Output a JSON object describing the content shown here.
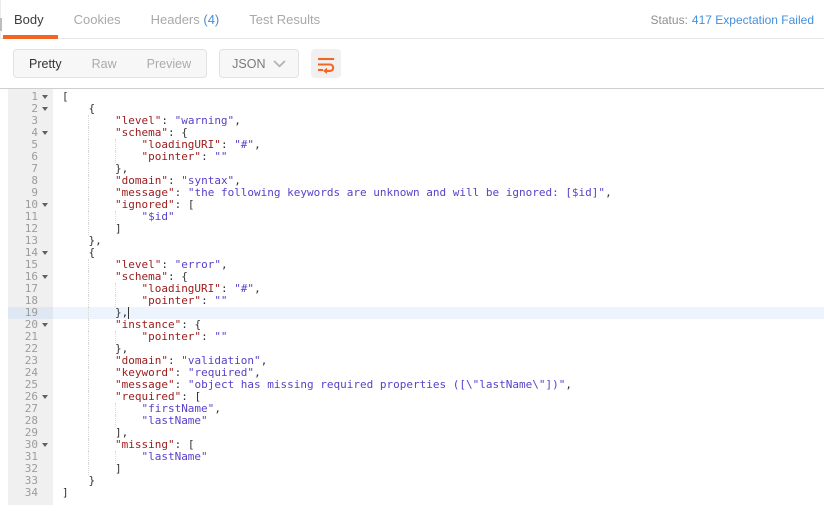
{
  "colors": {
    "accent_orange": "#f26524",
    "link_blue": "#4390db",
    "json_key": "#9b1b1b",
    "json_string": "#5a3fc8",
    "gutter_bg": "#f0f0f0",
    "active_line_bg": "#edf4fd"
  },
  "tabs": {
    "body": "Body",
    "cookies": "Cookies",
    "headers": "Headers",
    "headers_count": "(4)",
    "test_results": "Test Results"
  },
  "status": {
    "label": "Status:",
    "value": "417 Expectation Failed"
  },
  "toolbar": {
    "pretty": "Pretty",
    "raw": "Raw",
    "preview": "Preview",
    "language": "JSON",
    "chevron_icon": "chevron-down-icon",
    "wrap_icon": "wrap-lines-icon"
  },
  "editor": {
    "active_line": 19,
    "lines": [
      {
        "n": 1,
        "fold": true,
        "indent": 0,
        "toks": [
          [
            "p",
            "["
          ]
        ]
      },
      {
        "n": 2,
        "fold": true,
        "indent": 4,
        "toks": [
          [
            "p",
            "{"
          ]
        ]
      },
      {
        "n": 3,
        "indent": 8,
        "toks": [
          [
            "k",
            "\"level\""
          ],
          [
            "p",
            ": "
          ],
          [
            "v",
            "\"warning\""
          ],
          [
            "p",
            ","
          ]
        ]
      },
      {
        "n": 4,
        "fold": true,
        "indent": 8,
        "toks": [
          [
            "k",
            "\"schema\""
          ],
          [
            "p",
            ": {"
          ]
        ]
      },
      {
        "n": 5,
        "indent": 12,
        "toks": [
          [
            "k",
            "\"loadingURI\""
          ],
          [
            "p",
            ": "
          ],
          [
            "v",
            "\"#\""
          ],
          [
            "p",
            ","
          ]
        ]
      },
      {
        "n": 6,
        "indent": 12,
        "toks": [
          [
            "k",
            "\"pointer\""
          ],
          [
            "p",
            ": "
          ],
          [
            "v",
            "\"\""
          ]
        ]
      },
      {
        "n": 7,
        "indent": 8,
        "toks": [
          [
            "p",
            "},"
          ]
        ]
      },
      {
        "n": 8,
        "indent": 8,
        "toks": [
          [
            "k",
            "\"domain\""
          ],
          [
            "p",
            ": "
          ],
          [
            "v",
            "\"syntax\""
          ],
          [
            "p",
            ","
          ]
        ]
      },
      {
        "n": 9,
        "indent": 8,
        "toks": [
          [
            "k",
            "\"message\""
          ],
          [
            "p",
            ": "
          ],
          [
            "v",
            "\"the following keywords are unknown and will be ignored: [$id]\""
          ],
          [
            "p",
            ","
          ]
        ]
      },
      {
        "n": 10,
        "fold": true,
        "indent": 8,
        "toks": [
          [
            "k",
            "\"ignored\""
          ],
          [
            "p",
            ": ["
          ]
        ]
      },
      {
        "n": 11,
        "indent": 12,
        "toks": [
          [
            "v",
            "\"$id\""
          ]
        ]
      },
      {
        "n": 12,
        "indent": 8,
        "toks": [
          [
            "p",
            "]"
          ]
        ]
      },
      {
        "n": 13,
        "indent": 4,
        "toks": [
          [
            "p",
            "},"
          ]
        ]
      },
      {
        "n": 14,
        "fold": true,
        "indent": 4,
        "toks": [
          [
            "p",
            "{"
          ]
        ]
      },
      {
        "n": 15,
        "indent": 8,
        "toks": [
          [
            "k",
            "\"level\""
          ],
          [
            "p",
            ": "
          ],
          [
            "v",
            "\"error\""
          ],
          [
            "p",
            ","
          ]
        ]
      },
      {
        "n": 16,
        "fold": true,
        "indent": 8,
        "toks": [
          [
            "k",
            "\"schema\""
          ],
          [
            "p",
            ": {"
          ]
        ]
      },
      {
        "n": 17,
        "indent": 12,
        "toks": [
          [
            "k",
            "\"loadingURI\""
          ],
          [
            "p",
            ": "
          ],
          [
            "v",
            "\"#\""
          ],
          [
            "p",
            ","
          ]
        ]
      },
      {
        "n": 18,
        "indent": 12,
        "toks": [
          [
            "k",
            "\"pointer\""
          ],
          [
            "p",
            ": "
          ],
          [
            "v",
            "\"\""
          ]
        ]
      },
      {
        "n": 19,
        "indent": 8,
        "active": true,
        "cursor": true,
        "toks": [
          [
            "p",
            "},"
          ]
        ]
      },
      {
        "n": 20,
        "fold": true,
        "indent": 8,
        "toks": [
          [
            "k",
            "\"instance\""
          ],
          [
            "p",
            ": {"
          ]
        ]
      },
      {
        "n": 21,
        "indent": 12,
        "toks": [
          [
            "k",
            "\"pointer\""
          ],
          [
            "p",
            ": "
          ],
          [
            "v",
            "\"\""
          ]
        ]
      },
      {
        "n": 22,
        "indent": 8,
        "toks": [
          [
            "p",
            "},"
          ]
        ]
      },
      {
        "n": 23,
        "indent": 8,
        "toks": [
          [
            "k",
            "\"domain\""
          ],
          [
            "p",
            ": "
          ],
          [
            "v",
            "\"validation\""
          ],
          [
            "p",
            ","
          ]
        ]
      },
      {
        "n": 24,
        "indent": 8,
        "toks": [
          [
            "k",
            "\"keyword\""
          ],
          [
            "p",
            ": "
          ],
          [
            "v",
            "\"required\""
          ],
          [
            "p",
            ","
          ]
        ]
      },
      {
        "n": 25,
        "indent": 8,
        "toks": [
          [
            "k",
            "\"message\""
          ],
          [
            "p",
            ": "
          ],
          [
            "v",
            "\"object has missing required properties ([\\\"lastName\\\"])\""
          ],
          [
            "p",
            ","
          ]
        ]
      },
      {
        "n": 26,
        "fold": true,
        "indent": 8,
        "toks": [
          [
            "k",
            "\"required\""
          ],
          [
            "p",
            ": ["
          ]
        ]
      },
      {
        "n": 27,
        "indent": 12,
        "toks": [
          [
            "v",
            "\"firstName\""
          ],
          [
            "p",
            ","
          ]
        ]
      },
      {
        "n": 28,
        "indent": 12,
        "toks": [
          [
            "v",
            "\"lastName\""
          ]
        ]
      },
      {
        "n": 29,
        "indent": 8,
        "toks": [
          [
            "p",
            "],"
          ]
        ]
      },
      {
        "n": 30,
        "fold": true,
        "indent": 8,
        "toks": [
          [
            "k",
            "\"missing\""
          ],
          [
            "p",
            ": ["
          ]
        ]
      },
      {
        "n": 31,
        "indent": 12,
        "toks": [
          [
            "v",
            "\"lastName\""
          ]
        ]
      },
      {
        "n": 32,
        "indent": 8,
        "toks": [
          [
            "p",
            "]"
          ]
        ]
      },
      {
        "n": 33,
        "indent": 4,
        "toks": [
          [
            "p",
            "}"
          ]
        ]
      },
      {
        "n": 34,
        "indent": 0,
        "toks": [
          [
            "p",
            "]"
          ]
        ]
      }
    ]
  }
}
